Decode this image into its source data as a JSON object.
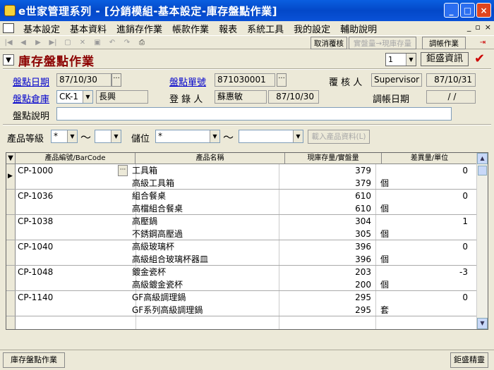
{
  "window": {
    "title": "e世家管理系列 - [分銷模組-基本設定-庫存盤點作業]",
    "controls": {
      "minimize": "_",
      "maximize": "□",
      "close": "×"
    }
  },
  "menu": {
    "items": [
      "基本設定",
      "基本資料",
      "進銷存作業",
      "帳款作業",
      "報表",
      "系統工具",
      "我的設定",
      "輔助說明"
    ],
    "mdi_controls": [
      "_",
      "▫",
      "×"
    ]
  },
  "toolbar": {
    "cancel_review_label": "取消覆核",
    "qty_label": "實盤量→現庫存量",
    "adjust_label": "調帳作業"
  },
  "header": {
    "title": "庫存盤點作業",
    "page_select": "1",
    "company": "鉅盛資訊"
  },
  "form": {
    "count_date_label": "盤點日期",
    "count_date": "87/10/30",
    "count_no_label": "盤點單號",
    "count_no": "871030001",
    "reviewer_label": "覆 核 人",
    "reviewer": "Supervisor",
    "review_date": "87/10/31",
    "warehouse_label": "盤點倉庫",
    "warehouse_code": "CK-1",
    "warehouse_name": "長興",
    "recorder_label": "登 錄 人",
    "recorder": "蘇惠敏",
    "record_date": "87/10/30",
    "adjust_date_label": "調帳日期",
    "adjust_date": "/ /",
    "desc_label": "盤點說明",
    "desc": ""
  },
  "filter": {
    "grade_label": "產品等級",
    "grade_from": "*",
    "grade_to": "",
    "tilde": "～",
    "location_label": "儲位",
    "location_from": "*",
    "location_to": "",
    "load_button": "載入產品資料(L)"
  },
  "grid": {
    "columns": [
      "產品編號/BarCode",
      "產品名稱",
      "現庫存量/實盤量",
      "差異量/單位"
    ],
    "rows": [
      {
        "code": "CP-1000",
        "name1": "工具箱",
        "name2": "高級工具箱",
        "qty1": "379",
        "qty2": "379",
        "diff": "0",
        "unit": "個"
      },
      {
        "code": "CP-1036",
        "name1": "組合餐桌",
        "name2": "高檔組合餐桌",
        "qty1": "610",
        "qty2": "610",
        "diff": "0",
        "unit": "個"
      },
      {
        "code": "CP-1038",
        "name1": "高壓鍋",
        "name2": "不銹鋼高壓過",
        "qty1": "304",
        "qty2": "305",
        "diff": "1",
        "unit": "個"
      },
      {
        "code": "CP-1040",
        "name1": "高級玻璃杯",
        "name2": "高級組合玻璃杯器皿",
        "qty1": "396",
        "qty2": "396",
        "diff": "0",
        "unit": "個"
      },
      {
        "code": "CP-1048",
        "name1": "鍍金瓷杯",
        "name2": "高級鍍金瓷杯",
        "qty1": "203",
        "qty2": "200",
        "diff": "-3",
        "unit": "個"
      },
      {
        "code": "CP-1140",
        "name1": "GF高級調理鍋",
        "name2": "GF系列高級調理鍋",
        "qty1": "295",
        "qty2": "295",
        "diff": "0",
        "unit": "套"
      }
    ]
  },
  "status": {
    "tab": "庫存盤點作業",
    "right": "鉅盛精靈"
  }
}
